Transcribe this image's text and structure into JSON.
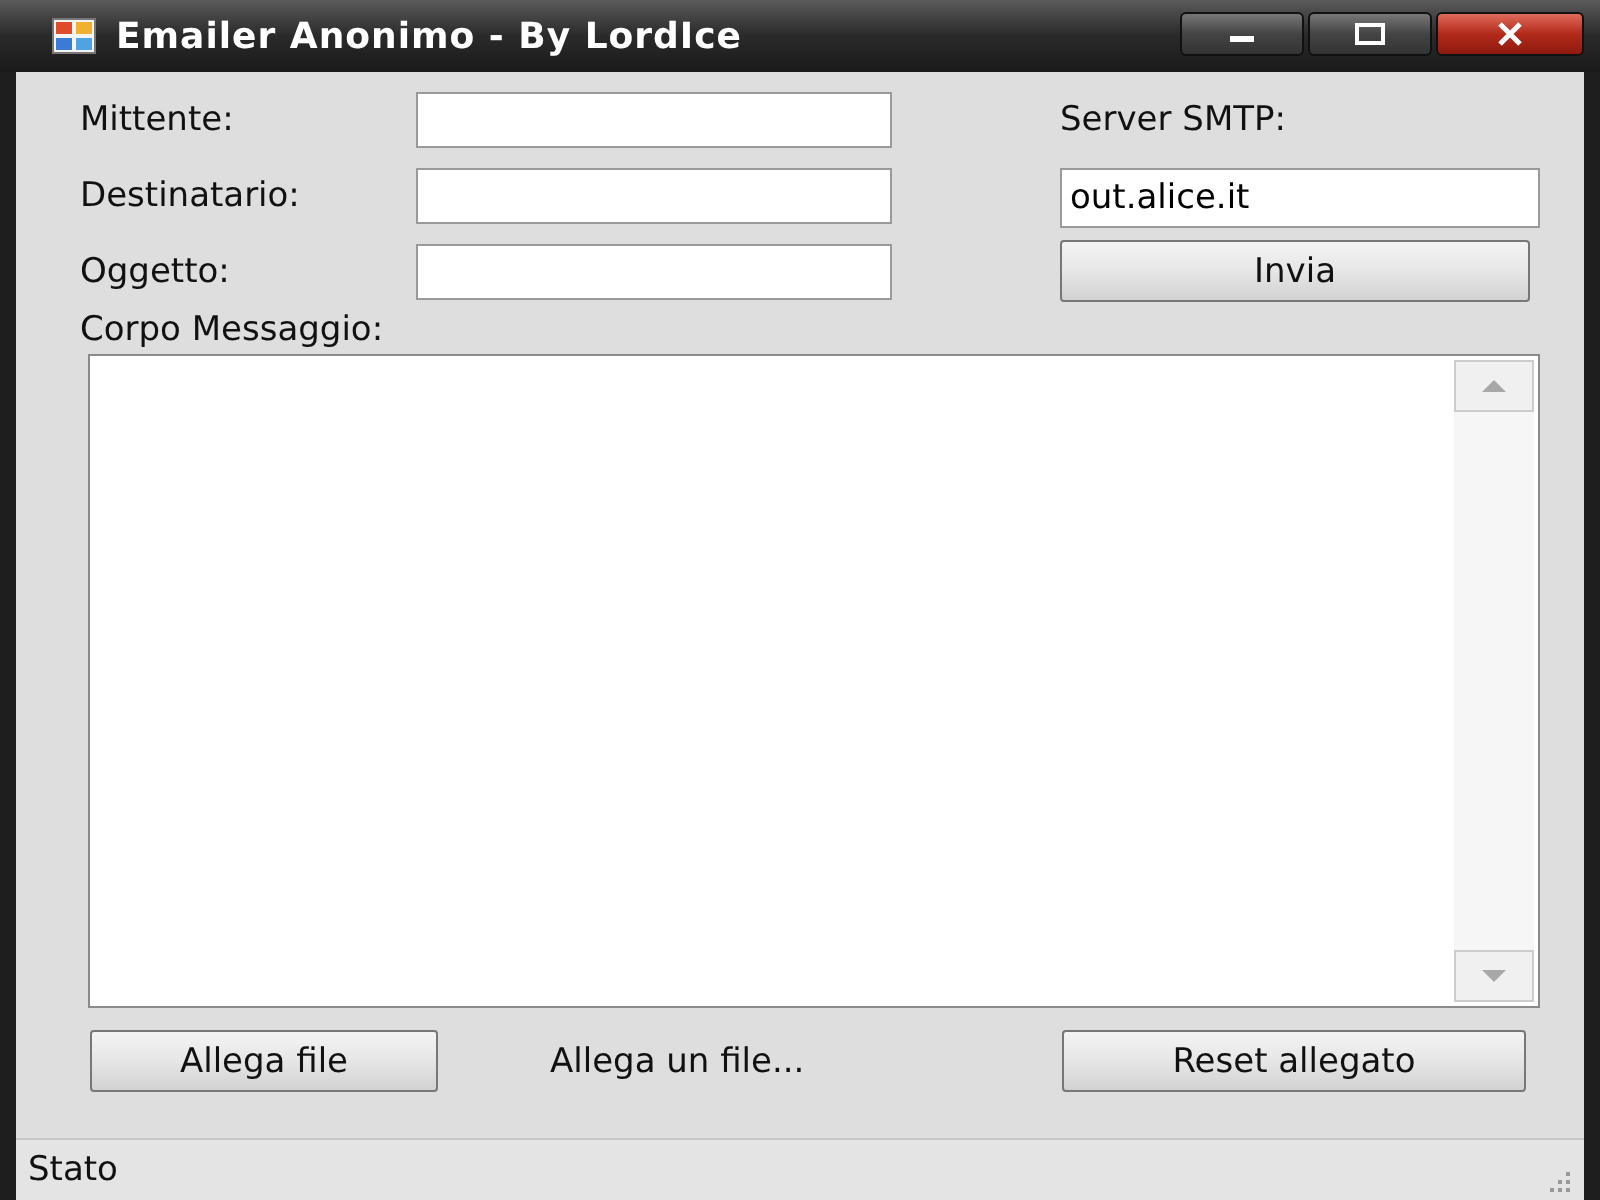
{
  "window": {
    "title": "Emailer Anonimo - By LordIce"
  },
  "fields": [
    {
      "label": "Mittente:"
    },
    {
      "label": "Destinatario:"
    },
    {
      "label": "Oggetto:"
    }
  ],
  "server": {
    "label": "Server SMTP:",
    "value": "out.alice.it"
  },
  "send_button": "Invia",
  "body": {
    "label": "Corpo Messaggio:"
  },
  "attach_button": "Allega file",
  "attach_status": "Allega un file...",
  "reset_button": "Reset allegato",
  "status_bar": "Stato"
}
